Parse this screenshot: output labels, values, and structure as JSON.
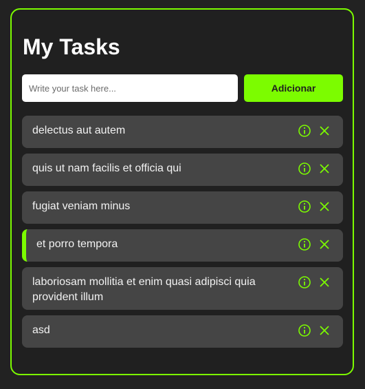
{
  "header": {
    "title": "My Tasks"
  },
  "form": {
    "placeholder": "Write your task here...",
    "add_label": "Adicionar"
  },
  "colors": {
    "accent": "#7cfc00",
    "background": "#222222",
    "task_bg": "#454545"
  },
  "tasks": [
    {
      "text": "delectus aut autem",
      "active": false,
      "info_icon": "info-circle-icon",
      "remove_icon": "close-x-icon"
    },
    {
      "text": "quis ut nam facilis et officia qui",
      "active": false,
      "info_icon": "info-circle-icon",
      "remove_icon": "close-x-icon"
    },
    {
      "text": "fugiat veniam minus",
      "active": false,
      "info_icon": "info-circle-icon",
      "remove_icon": "close-x-icon"
    },
    {
      "text": "et porro tempora",
      "active": true,
      "info_icon": "info-circle-icon",
      "remove_icon": "close-x-icon"
    },
    {
      "text": "laboriosam mollitia et enim quasi adipisci quia provident illum",
      "active": false,
      "info_icon": "info-circle-icon",
      "remove_icon": "close-x-icon"
    },
    {
      "text": "asd",
      "active": false,
      "info_icon": "info-circle-icon",
      "remove_icon": "close-x-icon"
    }
  ]
}
